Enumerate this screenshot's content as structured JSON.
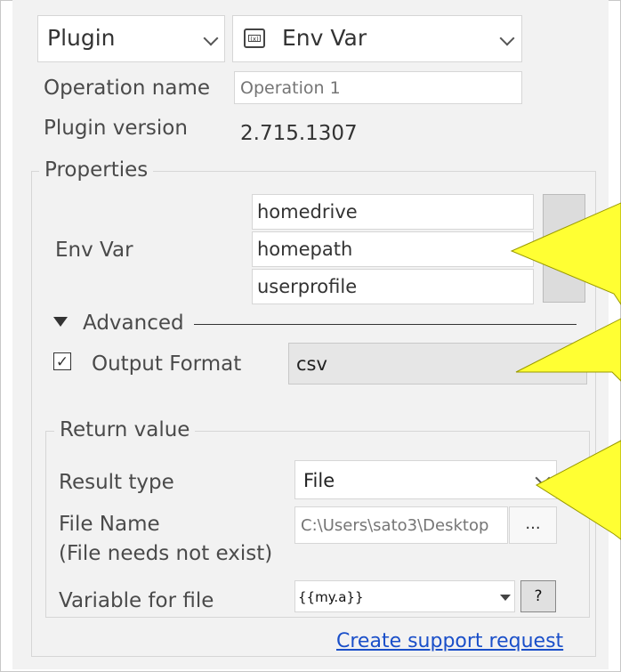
{
  "header": {
    "type_select": "Plugin",
    "plugin_select": "Env Var"
  },
  "operation": {
    "name_label": "Operation name",
    "name_placeholder": "Operation 1",
    "version_label": "Plugin version",
    "version_value": "2.715.1307"
  },
  "properties": {
    "legend": "Properties",
    "env_var_label": "Env Var",
    "env_vars": [
      "homedrive",
      "homepath",
      "userprofile"
    ],
    "add_button": "+"
  },
  "advanced": {
    "label": "Advanced",
    "output_format_label": "Output Format",
    "output_format_checked": true,
    "output_format_value": "csv"
  },
  "return_value": {
    "legend": "Return value",
    "result_type_label": "Result type",
    "result_type_value": "File",
    "file_name_label": "File Name",
    "file_name_hint": "(File needs not exist)",
    "file_name_placeholder": "C:\\Users\\sato3\\Desktop",
    "browse_button": "...",
    "variable_label": "Variable for file",
    "variable_value": "{{my.a}}",
    "help_button": "?"
  },
  "footer": {
    "support_link": "Create support request"
  },
  "colors": {
    "callout": "#ffff33",
    "link": "#1a4fc9",
    "panel_bg": "#f2f2f2"
  }
}
